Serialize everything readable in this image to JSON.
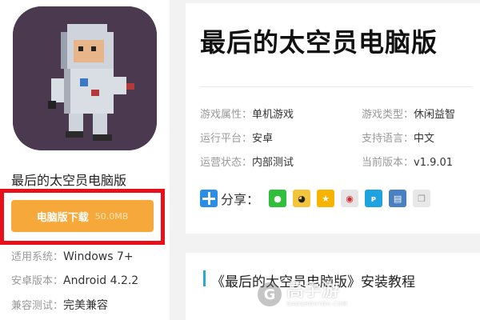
{
  "left_panel": {
    "app_name": "最后的太空员电脑版",
    "download_button": {
      "label": "电脑版下载",
      "size": "50.0MB"
    },
    "info": [
      {
        "key": "适用系统：",
        "value": "Windows 7+"
      },
      {
        "key": "安卓版本：",
        "value": "Android 4.2.2"
      },
      {
        "key": "兼容测试：",
        "value": "完美兼容"
      }
    ]
  },
  "main": {
    "title": "最后的太空员电脑版",
    "attributes": [
      {
        "key": "游戏属性：",
        "value": "单机游戏"
      },
      {
        "key": "游戏类型：",
        "value": "休闲益智"
      },
      {
        "key": "运行平台：",
        "value": "安卓"
      },
      {
        "key": "支持语言：",
        "value": "中文"
      },
      {
        "key": "运营状态：",
        "value": "内部测试"
      },
      {
        "key": "当前版本：",
        "value": "v1.9.01"
      }
    ],
    "share": {
      "label": "分享：",
      "icons": [
        "wechat-icon",
        "qq-icon",
        "qzone-icon",
        "weibo-icon",
        "tencent-weibo-icon",
        "print-icon",
        "copy-icon"
      ]
    }
  },
  "tutorial": {
    "title": "《最后的太空员电脑版》安装教程"
  },
  "watermark": {
    "logo": "G",
    "cn": "高手游",
    "en": "GAOSHOUYOU.COM"
  },
  "colors": {
    "download": "#f7a83a",
    "highlight_frame": "#e8101a",
    "accent": "#2aa8d8"
  }
}
